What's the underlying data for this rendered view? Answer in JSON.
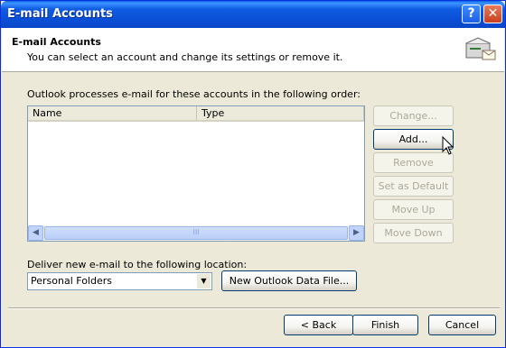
{
  "window": {
    "title": "E-mail Accounts"
  },
  "header": {
    "title": "E-mail Accounts",
    "subtitle": "You can select an account and change its settings or remove it."
  },
  "accounts": {
    "order_label": "Outlook processes e-mail for these accounts in the following order:",
    "columns": [
      "Name",
      "Type"
    ],
    "rows": [],
    "scroll_thumb_glyph": "III"
  },
  "side_buttons": {
    "change": "Change...",
    "add": "Add...",
    "remove": "Remove",
    "set_default": "Set as Default",
    "move_up": "Move Up",
    "move_down": "Move Down"
  },
  "delivery": {
    "label": "Deliver new e-mail to the following location:",
    "selected": "Personal Folders",
    "new_data_file": "New Outlook Data File..."
  },
  "footer": {
    "back": "< Back",
    "finish": "Finish",
    "cancel": "Cancel"
  }
}
